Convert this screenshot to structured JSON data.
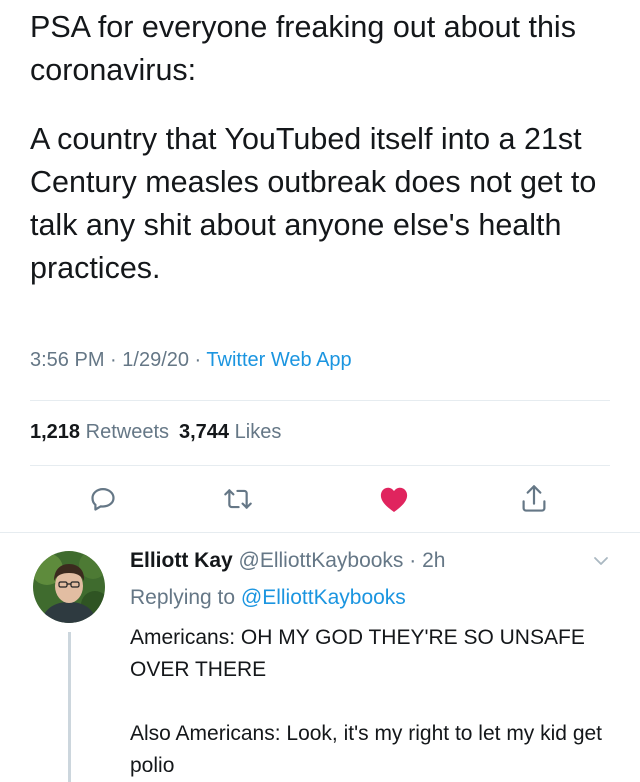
{
  "tweet": {
    "paragraph1": "PSA for everyone freaking out about this coronavirus:",
    "paragraph2": "A country that YouTubed itself into a 21st Century measles outbreak does not get to talk any shit about anyone else's health practices.",
    "time": "3:56 PM",
    "date": "1/29/20",
    "separator": " · ",
    "app": "Twitter Web App",
    "retweets_count": "1,218",
    "retweets_label": "Retweets",
    "likes_count": "3,744",
    "likes_label": "Likes"
  },
  "actions": {
    "reply_icon": "reply-icon",
    "retweet_icon": "retweet-icon",
    "like_icon": "heart-icon",
    "share_icon": "share-icon",
    "like_color": "#e0245e",
    "icon_color": "#657786"
  },
  "reply": {
    "name": "Elliott Kay",
    "handle": "@ElliottKaybooks",
    "separator": " · ",
    "age": "2h",
    "replying_label": "Replying to",
    "replying_handle": "@ElliottKaybooks",
    "body": "Americans: OH MY GOD THEY'RE SO UNSAFE OVER THERE\n\nAlso Americans: Look, it's my right to let my kid get polio"
  },
  "colors": {
    "link": "#1b95e0",
    "secondary_text": "#657786",
    "primary_text": "#14171a",
    "divider": "#e6ecf0"
  }
}
